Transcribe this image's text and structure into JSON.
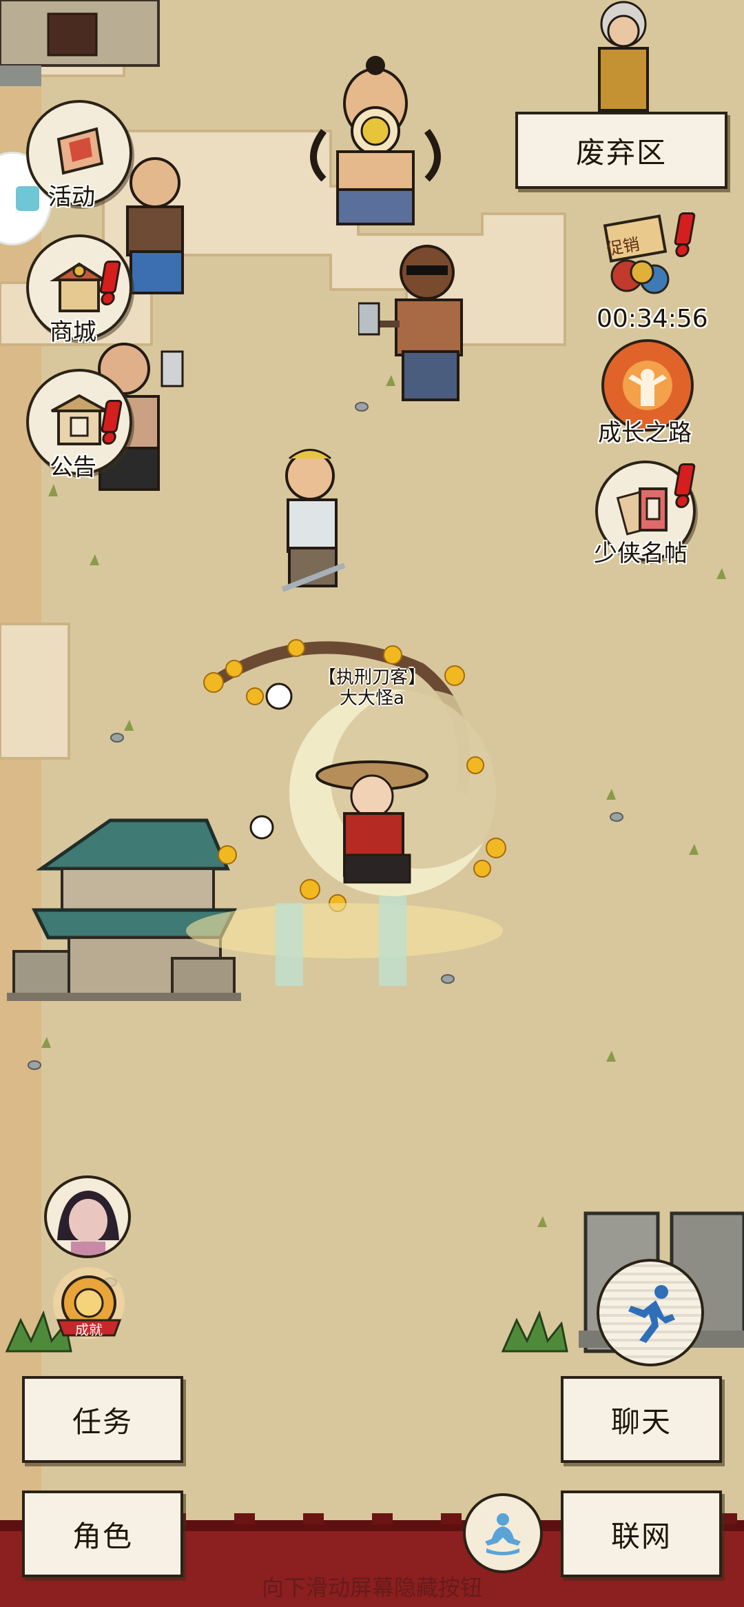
{
  "location": {
    "label": "废弃区"
  },
  "left_menu": [
    {
      "label": "活动",
      "icon": "flag-icon"
    },
    {
      "label": "商城",
      "icon": "shop-icon"
    },
    {
      "label": "公告",
      "icon": "notice-board-icon"
    }
  ],
  "right_menu": {
    "promo": {
      "sign": "促销",
      "timer": "00:34:56"
    },
    "growth": {
      "label": "成长之路"
    },
    "profile": {
      "label": "少侠名帖"
    }
  },
  "player": {
    "title": "【执刑刀客】",
    "name": "大大怪a"
  },
  "achievement": {
    "label": "成就"
  },
  "bottom_buttons": {
    "task": "任务",
    "chat": "聊天",
    "role": "角色",
    "network": "联网"
  },
  "hint": "向下滑动屏幕隐藏按钮",
  "colors": {
    "ground": "#d8c79c",
    "path": "#ecdcc0",
    "wall": "#8c1f1f",
    "badge": "#d51e1e"
  }
}
